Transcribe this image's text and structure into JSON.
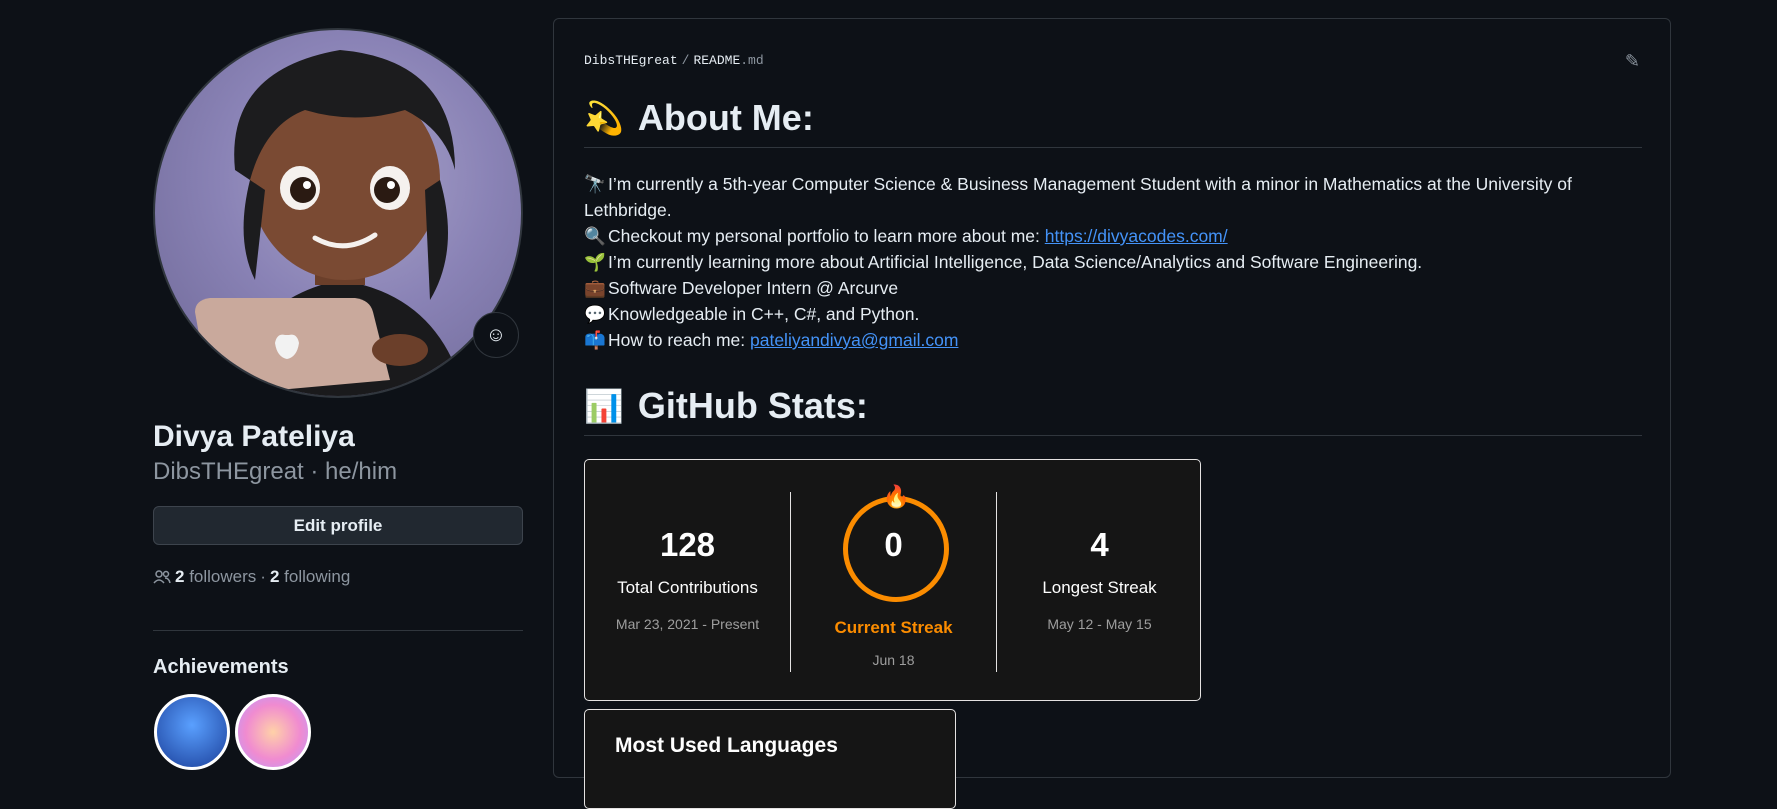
{
  "profile": {
    "name": "Divya Pateliya",
    "login_pronouns": "DibsTHEgreat · he/him",
    "edit_label": "Edit profile",
    "followers_count": "2",
    "followers_label": "followers",
    "following_count": "2",
    "following_label": "following",
    "achievements_title": "Achievements"
  },
  "readme": {
    "path_user": "DibsTHEgreat",
    "path_sep": "/",
    "path_file": "README",
    "path_ext": ".md",
    "about_heading": "About Me:",
    "about_items": [
      {
        "icon": "🔭",
        "text": "I’m currently a 5th-year Computer Science & Business Management Student with a minor in Mathematics at the University of Lethbridge."
      },
      {
        "icon": "🔍",
        "text": "Checkout my personal portfolio to learn more about me: ",
        "link": "https://divyacodes.com/"
      },
      {
        "icon": "🌱",
        "text": "I’m currently learning more about Artificial Intelligence, Data Science/Analytics and Software Engineering."
      },
      {
        "icon": "💼",
        "text": "Software Developer Intern @ Arcurve"
      },
      {
        "icon": "💬",
        "text": "Knowledgeable in C++, C#, and Python."
      },
      {
        "icon": "📫",
        "text": "How to reach me: ",
        "link": "pateliyandivya@gmail.com"
      }
    ],
    "stats_heading": "GitHub Stats:"
  },
  "streak_card": {
    "total_value": "128",
    "total_label": "Total Contributions",
    "total_range": "Mar 23, 2021 - Present",
    "current_value": "0",
    "current_label": "Current Streak",
    "current_range": "Jun 18",
    "longest_value": "4",
    "longest_label": "Longest Streak",
    "longest_range": "May 12 - May 15",
    "accent": "#fb8c00"
  },
  "languages_card": {
    "title": "Most Used Languages"
  }
}
